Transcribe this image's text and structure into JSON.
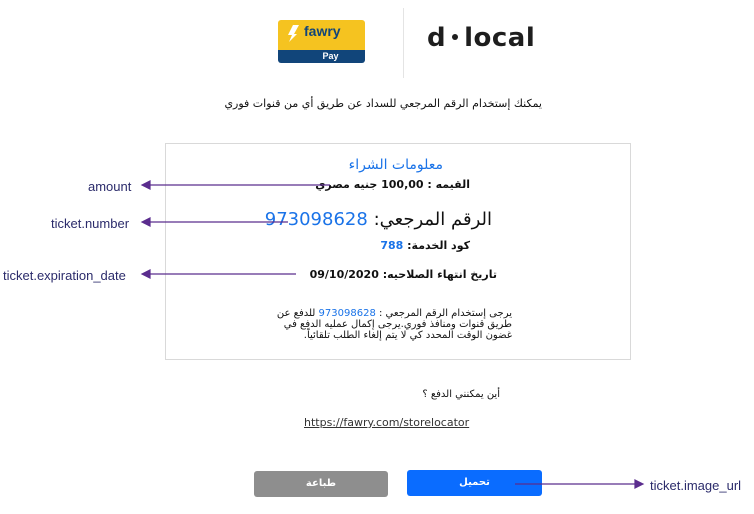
{
  "logos": {
    "fawry_word": "fawry",
    "fawry_sub": "Pay",
    "dlocal_left": "d",
    "dlocal_right": "local"
  },
  "intro_text": "يمكنك إستخدام الرقم المرجعي للسداد عن طريق أي من قنوات فوري",
  "card": {
    "title": "معلومات الشراء",
    "amount_label": "القيمه :",
    "amount_value": "100,00 جنيه مصري",
    "ref_label": "الرقم المرجعي:",
    "ref_value": "973098628",
    "service_label": "كود الخدمة:",
    "service_value": "788",
    "expiry_label": "تاريخ انتهاء الصلاحيه:",
    "expiry_value": "09/10/2020",
    "instructions_pre": "يرجى إستخدام الرقم المرجعي :",
    "instructions_ref": "973098628",
    "instructions_post": "للدفع عن طريق قنوات ومنافذ فوري.يرجى إكمال عمليه الدفع في غضون الوقت المحدد كي لا يتم إلغاء الطلب تلقائياً."
  },
  "where_to_pay": "أين يمكنني الدفع ؟",
  "store_link": "https://fawry.com/storelocator",
  "buttons": {
    "print": "طباعة",
    "download": "تحميل"
  },
  "annotations": {
    "amount": "amount",
    "ticket_number": "ticket.number",
    "expiration": "ticket.expiration_date",
    "image_url": "ticket.image_url"
  },
  "colors": {
    "accent_blue": "#1a73e8",
    "download_button": "#0a6cff",
    "print_button": "#8e8e8e",
    "annotation_arrow": "#5b2d8e",
    "fawry_yellow": "#f5c320",
    "fawry_navy": "#11457a"
  }
}
